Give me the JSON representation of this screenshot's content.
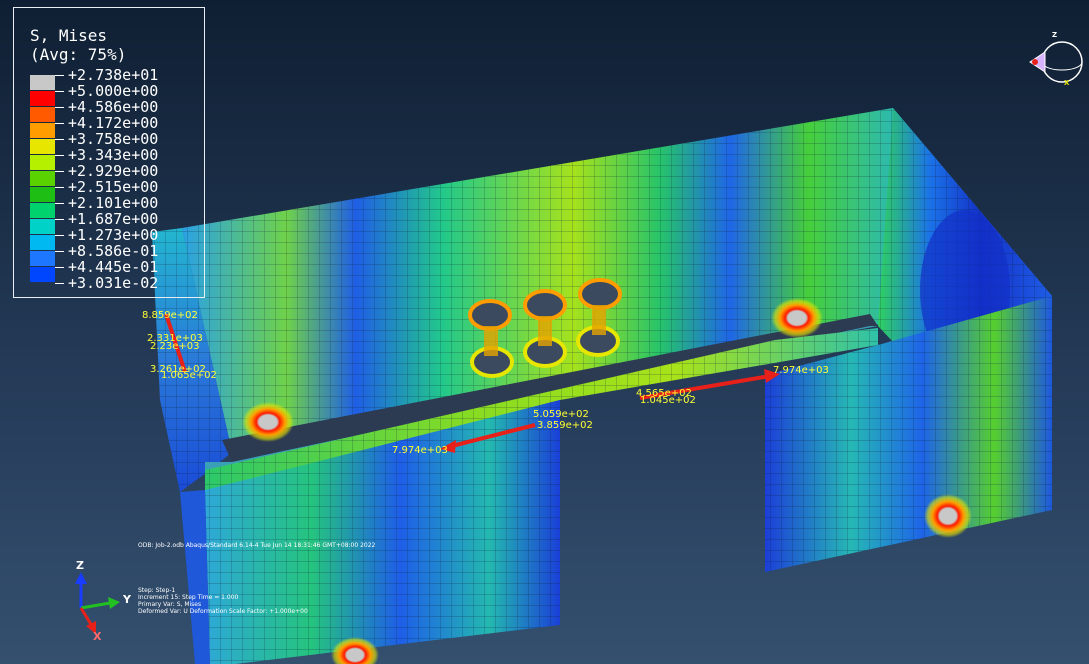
{
  "legend": {
    "title": "S, Mises",
    "subtitle": "(Avg: 75%)",
    "values": [
      "+2.738e+01",
      "+5.000e+00",
      "+4.586e+00",
      "+4.172e+00",
      "+3.758e+00",
      "+3.343e+00",
      "+2.929e+00",
      "+2.515e+00",
      "+2.101e+00",
      "+1.687e+00",
      "+1.273e+00",
      "+8.586e-01",
      "+4.445e-01",
      "+3.031e-02"
    ],
    "colors": [
      "#c8c8c8",
      "#ff0000",
      "#ff5a00",
      "#ff9c00",
      "#e6e600",
      "#b4f000",
      "#5ad200",
      "#1ebe14",
      "#00d26e",
      "#00d2c8",
      "#00b9f0",
      "#1e78ff",
      "#0046ff",
      "#0000d2"
    ]
  },
  "odb_line": "ODB: Job-2.odb    Abaqus/Standard 6.14-4    Tue Jun 14 18:31:46 GMT+08:00 2022",
  "step_info": [
    "Step: Step-1",
    "Increment     15: Step Time =    1.000",
    "Primary Var: S, Mises",
    "Deformed Var: U   Deformation Scale Factor: +1.000e+00"
  ],
  "load_labels": [
    "8.859e+02",
    "2.331e+03",
    "2.23e+03",
    "3.261e+02",
    "1.065e+02",
    "5.059e+02",
    "3.859e+02",
    "4.565e+02",
    "1.045e+02",
    "7.974e+03",
    "7.974e+03"
  ],
  "triad": {
    "z": "Z",
    "y": "Y",
    "x": "X"
  },
  "view_triad": {
    "z": "Z",
    "x": "X"
  }
}
